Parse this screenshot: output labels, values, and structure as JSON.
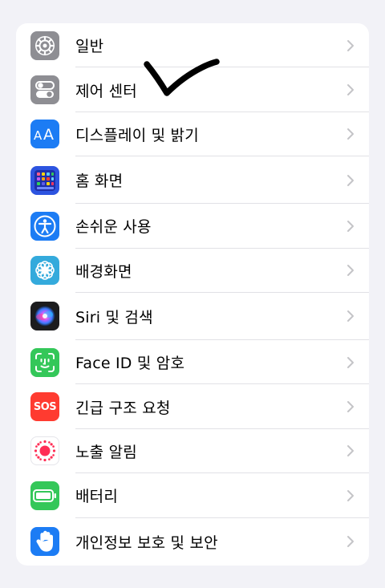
{
  "settings": {
    "items": [
      {
        "label": "일반",
        "icon": "gear-icon",
        "color": "#8E8E93"
      },
      {
        "label": "제어 센터",
        "icon": "toggles-icon",
        "color": "#8E8E93"
      },
      {
        "label": "디스플레이 및 밝기",
        "icon": "text-size-icon",
        "color": "#1C7CF4"
      },
      {
        "label": "홈 화면",
        "icon": "app-grid-icon",
        "color": "#2D54E0"
      },
      {
        "label": "손쉬운 사용",
        "icon": "accessibility-icon",
        "color": "#1C7CF4"
      },
      {
        "label": "배경화면",
        "icon": "flower-icon",
        "color": "#34AADC"
      },
      {
        "label": "Siri 및 검색",
        "icon": "siri-icon",
        "color": "#1C1C1E"
      },
      {
        "label": "Face ID 및 암호",
        "icon": "face-id-icon",
        "color": "#34C759"
      },
      {
        "label": "긴급 구조 요청",
        "icon": "sos-icon",
        "color": "#FF3B30",
        "icon_text": "SOS"
      },
      {
        "label": "노출 알림",
        "icon": "exposure-icon",
        "color": "#FF2D55"
      },
      {
        "label": "배터리",
        "icon": "battery-icon",
        "color": "#34C759"
      },
      {
        "label": "개인정보 보호 및 보안",
        "icon": "hand-icon",
        "color": "#1C7CF4"
      }
    ]
  },
  "accent_colors": {
    "chevron": "#C4C4C7",
    "separator": "#E1E1E6",
    "background": "#F2F2F7"
  }
}
